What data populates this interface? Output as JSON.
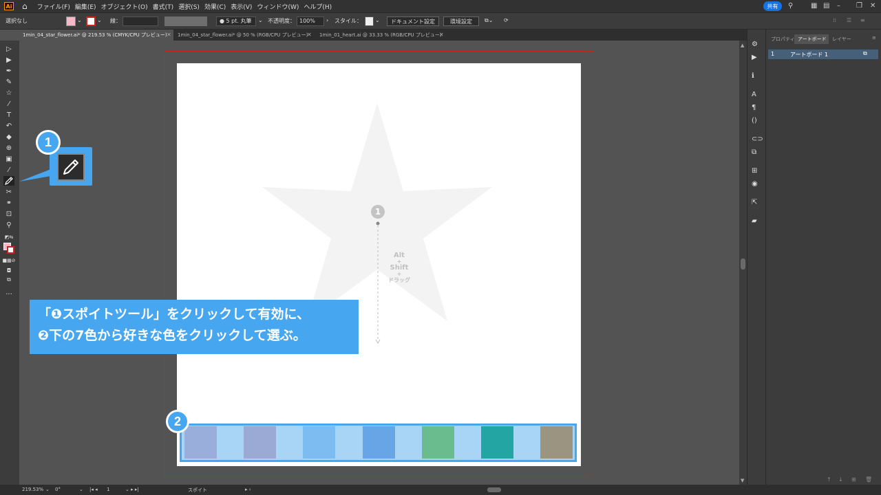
{
  "app": {
    "logo": "Ai"
  },
  "menubar": {
    "items": [
      "ファイル(F)",
      "編集(E)",
      "オブジェクト(O)",
      "書式(T)",
      "選択(S)",
      "効果(C)",
      "表示(V)",
      "ウィンドウ(W)",
      "ヘルプ(H)"
    ],
    "share_label": "共有"
  },
  "control_bar": {
    "selection_label": "選択なし",
    "stroke_label": "線：",
    "brush_label": "5 pt. 丸筆",
    "opacity_label": "不透明度：",
    "opacity_value": "100%",
    "style_label": "スタイル：",
    "doc_settings_label": "ドキュメント設定",
    "prefs_label": "環境設定",
    "fill_color": "#f4b8c6",
    "stroke_color": "#cc2222"
  },
  "tabs": [
    {
      "label": "1min_04_star_flower.ai* @ 219.53 % (CMYK/CPU プレビュー)",
      "active": true
    },
    {
      "label": "1min_04_star_flower.ai* @ 50 % (RGB/CPU プレビュー)",
      "active": false
    },
    {
      "label": "1min_01_heart.ai @ 33.33 % (RGB/CPU プレビュー)",
      "active": false
    }
  ],
  "panel": {
    "tabs": [
      "プロパティ",
      "アートボード",
      "レイヤー"
    ],
    "artboard_row": {
      "index": "1",
      "name": "アートボード 1"
    }
  },
  "status_bar": {
    "zoom": "219.53%",
    "rotation": "0°",
    "artboard_num": "1",
    "tool_name": "スポイト"
  },
  "annotations": {
    "badge1": "1",
    "badge2": "2",
    "canvas_badge": "1",
    "drag_lines": [
      "Alt",
      "+",
      "Shift",
      "+",
      "ドラッグ"
    ],
    "callout_line1": "「❶スポイトツール」をクリックして有効に、",
    "callout_line2": "❷下の7色から好きな色をクリックして選ぶ。"
  },
  "swatches": [
    "#9aaedb",
    "#9aaad4",
    "#7cbcf0",
    "#68a5e6",
    "#6abb8e",
    "#23a6a3",
    "#9a9480"
  ],
  "colors": {
    "accent": "#47a6f0",
    "swatch_bg": "#a8d4f5",
    "star": "#f3f3f3",
    "bleed": "#cc2222"
  }
}
